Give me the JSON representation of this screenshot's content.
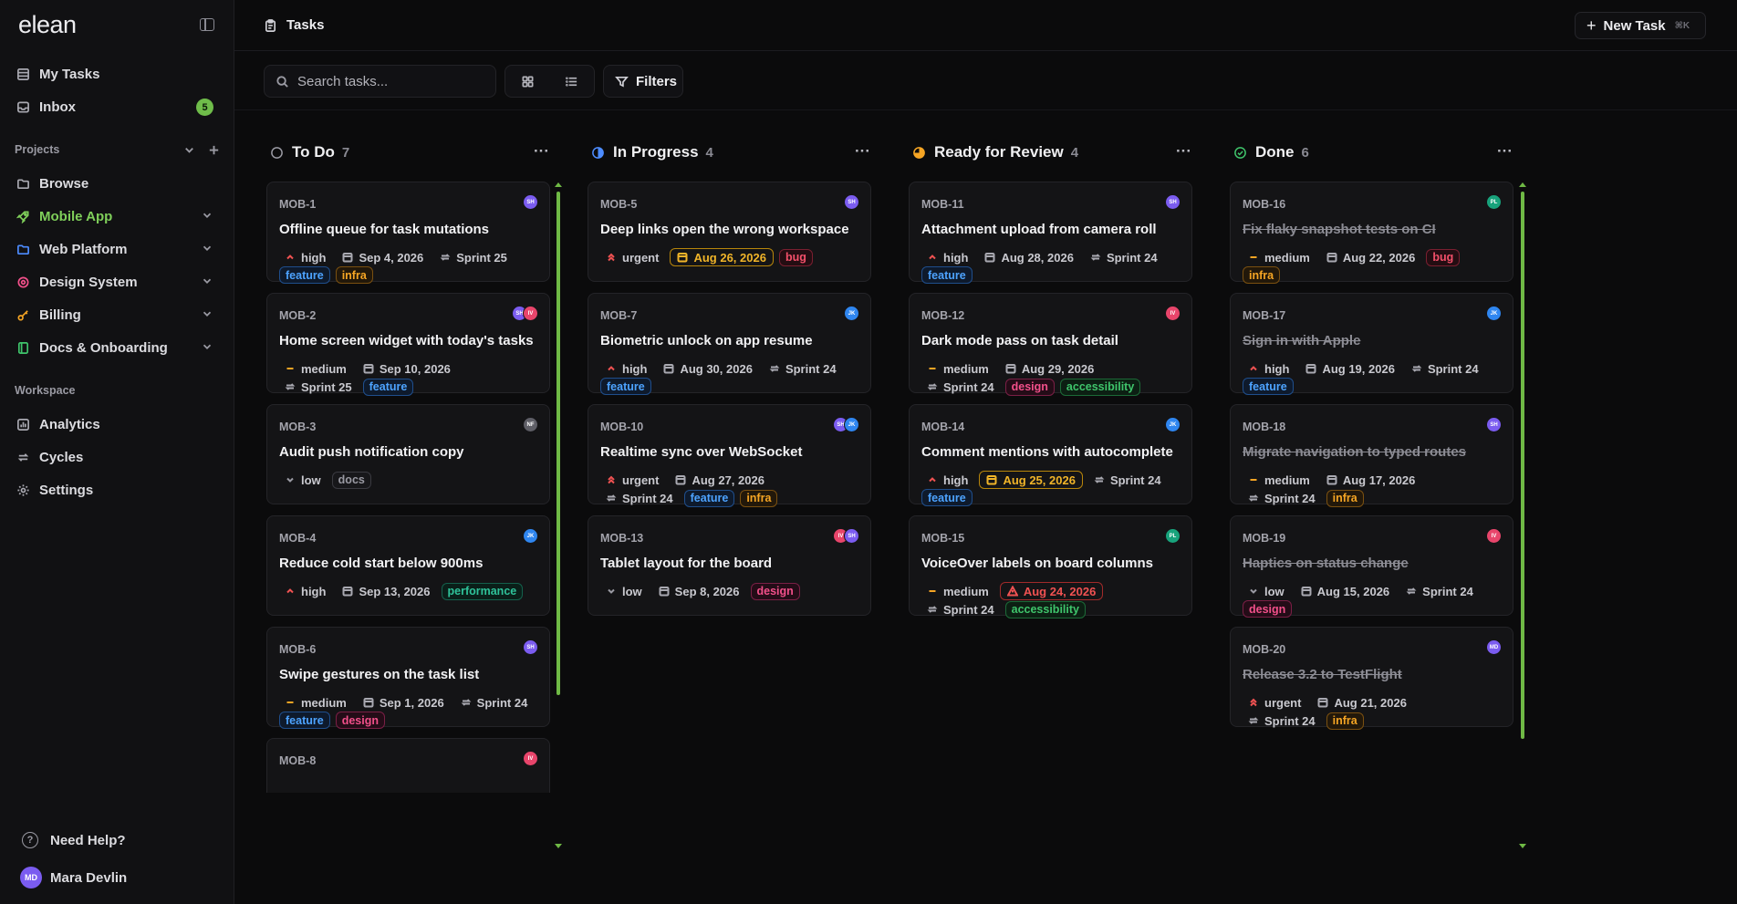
{
  "app": {
    "logo": "elean"
  },
  "sidebar": {
    "my_tasks": "My Tasks",
    "inbox": "Inbox",
    "inbox_count": "5",
    "projects_label": "Projects",
    "projects": [
      {
        "label": "Browse",
        "icon": "folder-icon"
      },
      {
        "label": "Mobile App",
        "icon": "rocket-icon",
        "active": true
      },
      {
        "label": "Web Platform",
        "icon": "folder-icon"
      },
      {
        "label": "Design System",
        "icon": "palette-icon"
      },
      {
        "label": "Billing",
        "icon": "key-icon"
      },
      {
        "label": "Docs & Onboarding",
        "icon": "book-icon"
      }
    ],
    "workspace_label": "Workspace",
    "workspace": [
      {
        "label": "Analytics",
        "icon": "chart-icon"
      },
      {
        "label": "Cycles",
        "icon": "cycle-icon"
      },
      {
        "label": "Settings",
        "icon": "gear-icon"
      }
    ],
    "help": "Need Help?",
    "user": {
      "name": "Mara Devlin",
      "initials": "MD"
    }
  },
  "header": {
    "title": "Tasks",
    "new_task": "New Task",
    "shortcut": "⌘K"
  },
  "toolbar": {
    "search_placeholder": "Search tasks...",
    "filters": "Filters"
  },
  "colors": {
    "accent": "#6fbd4a",
    "todo": "#9a9aa3",
    "in_progress": "#4d8cff",
    "review": "#f5a524",
    "done": "#3fc46b"
  },
  "columns": [
    {
      "name": "To Do",
      "count": "7",
      "cards": [
        {
          "id": "MOB-1",
          "title": "Offline queue for task mutations",
          "priority": "high",
          "date": "Sep 4, 2026",
          "sprint": "Sprint 25",
          "tags": [
            "feature",
            "infra"
          ],
          "avatars": [
            "SH"
          ]
        },
        {
          "id": "MOB-2",
          "title": "Home screen widget with today's tasks",
          "priority": "medium",
          "date": "Sep 10, 2026",
          "sprint": "Sprint 25",
          "tags": [
            "feature"
          ],
          "avatars": [
            "SH",
            "IV"
          ]
        },
        {
          "id": "MOB-3",
          "title": "Audit push notification copy",
          "priority": "low",
          "tags": [
            "docs"
          ],
          "avatars": [
            "NF"
          ]
        },
        {
          "id": "MOB-4",
          "title": "Reduce cold start below 900ms",
          "priority": "high",
          "date": "Sep 13, 2026",
          "tags": [
            "performance"
          ],
          "avatars": [
            "JK"
          ]
        },
        {
          "id": "MOB-6",
          "title": "Swipe gestures on the task list",
          "priority": "medium",
          "date": "Sep 1, 2026",
          "sprint": "Sprint 24",
          "tags": [
            "feature",
            "design"
          ],
          "avatars": [
            "SH"
          ]
        },
        {
          "id": "MOB-8",
          "title": "",
          "avatars": [
            "IV"
          ]
        }
      ]
    },
    {
      "name": "In Progress",
      "count": "4",
      "cards": [
        {
          "id": "MOB-5",
          "title": "Deep links open the wrong workspace",
          "priority": "urgent",
          "date": "Aug 26, 2026",
          "date_state": "warn",
          "tags": [
            "bug"
          ],
          "avatars": [
            "SH"
          ]
        },
        {
          "id": "MOB-7",
          "title": "Biometric unlock on app resume",
          "priority": "high",
          "date": "Aug 30, 2026",
          "sprint": "Sprint 24",
          "tags": [
            "feature"
          ],
          "avatars": [
            "JK"
          ]
        },
        {
          "id": "MOB-10",
          "title": "Realtime sync over WebSocket",
          "priority": "urgent",
          "date": "Aug 27, 2026",
          "sprint": "Sprint 24",
          "tags": [
            "feature",
            "infra"
          ],
          "avatars": [
            "SH",
            "JK"
          ]
        },
        {
          "id": "MOB-13",
          "title": "Tablet layout for the board",
          "priority": "low",
          "date": "Sep 8, 2026",
          "tags": [
            "design"
          ],
          "avatars": [
            "IV",
            "SH"
          ]
        }
      ]
    },
    {
      "name": "Ready for Review",
      "count": "4",
      "cards": [
        {
          "id": "MOB-11",
          "title": "Attachment upload from camera roll",
          "priority": "high",
          "date": "Aug 28, 2026",
          "sprint": "Sprint 24",
          "tags": [
            "feature"
          ],
          "avatars": [
            "SH"
          ]
        },
        {
          "id": "MOB-12",
          "title": "Dark mode pass on task detail",
          "priority": "medium",
          "date": "Aug 29, 2026",
          "sprint": "Sprint 24",
          "tags": [
            "design",
            "accessibility"
          ],
          "avatars": [
            "IV"
          ]
        },
        {
          "id": "MOB-14",
          "title": "Comment mentions with autocomplete",
          "priority": "high",
          "date": "Aug 25, 2026",
          "date_state": "warn",
          "sprint": "Sprint 24",
          "tags": [
            "feature"
          ],
          "avatars": [
            "JK"
          ]
        },
        {
          "id": "MOB-15",
          "title": "VoiceOver labels on board columns",
          "priority": "medium",
          "date": "Aug 24, 2026",
          "date_state": "overdue",
          "sprint": "Sprint 24",
          "tags": [
            "accessibility"
          ],
          "avatars": [
            "PL"
          ]
        }
      ]
    },
    {
      "name": "Done",
      "count": "6",
      "cards": [
        {
          "id": "MOB-16",
          "title": "Fix flaky snapshot tests on CI",
          "done": true,
          "priority": "medium",
          "date": "Aug 22, 2026",
          "tags": [
            "bug",
            "infra"
          ],
          "avatars": [
            "PL"
          ]
        },
        {
          "id": "MOB-17",
          "title": "Sign in with Apple",
          "done": true,
          "priority": "high",
          "date": "Aug 19, 2026",
          "sprint": "Sprint 24",
          "tags": [
            "feature"
          ],
          "avatars": [
            "JK"
          ]
        },
        {
          "id": "MOB-18",
          "title": "Migrate navigation to typed routes",
          "done": true,
          "priority": "medium",
          "date": "Aug 17, 2026",
          "sprint": "Sprint 24",
          "tags": [
            "infra"
          ],
          "avatars": [
            "SH"
          ]
        },
        {
          "id": "MOB-19",
          "title": "Haptics on status change",
          "done": true,
          "priority": "low",
          "date": "Aug 15, 2026",
          "sprint": "Sprint 24",
          "tags": [
            "design"
          ],
          "avatars": [
            "IV"
          ]
        },
        {
          "id": "MOB-20",
          "title": "Release 3.2 to TestFlight",
          "done": true,
          "priority": "urgent",
          "date": "Aug 21, 2026",
          "sprint": "Sprint 24",
          "tags": [
            "infra"
          ],
          "avatars": [
            "MD"
          ]
        }
      ]
    }
  ]
}
